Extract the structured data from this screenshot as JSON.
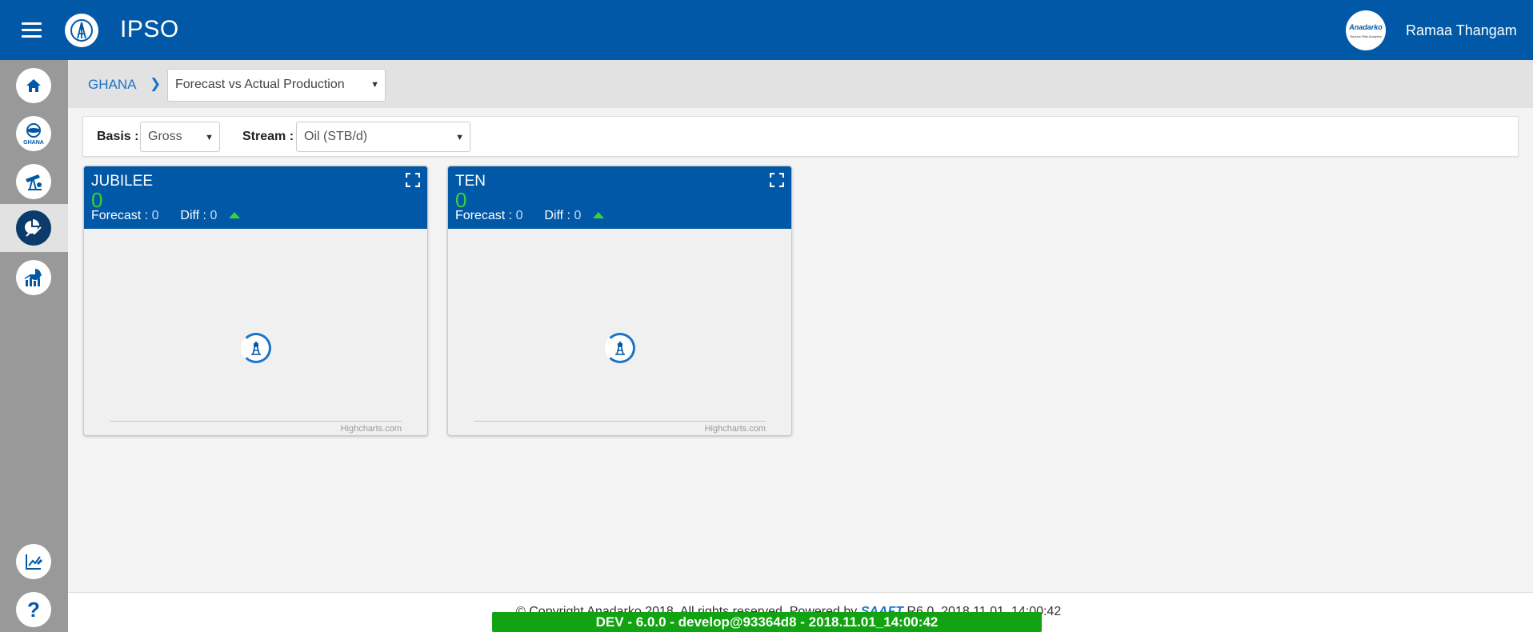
{
  "header": {
    "app_title": "IPSO",
    "user_name": "Ramaa Thangam",
    "avatar_brand": "Anadarko",
    "avatar_sub": "Reduce Risk Analytics",
    "menu_icon": "hamburger-icon",
    "logo_icon": "derrick-icon"
  },
  "sidebar": {
    "items": [
      {
        "icon": "home-icon"
      },
      {
        "icon": "ghana-icon",
        "label": "GHANA"
      },
      {
        "icon": "pumpjack-icon"
      },
      {
        "icon": "forecast-chart-icon",
        "active": true
      },
      {
        "icon": "analytics-chart-icon"
      },
      {
        "icon": "data-edit-icon"
      },
      {
        "icon": "help-icon",
        "label": "?"
      }
    ]
  },
  "breadcrumb": {
    "root": "GHANA",
    "separator": "❯",
    "page_select": "Forecast vs Actual Production"
  },
  "filters": {
    "basis_label": "Basis :",
    "basis_value": "Gross",
    "stream_label": "Stream :",
    "stream_value": "Oil (STB/d)"
  },
  "cards": [
    {
      "title": "JUBILEE",
      "value": "0",
      "forecast_label": "Forecast : ",
      "forecast_value": "0",
      "diff_label": "Diff : ",
      "diff_value": "0",
      "credits": "Highcharts.com"
    },
    {
      "title": "TEN",
      "value": "0",
      "forecast_label": "Forecast : ",
      "forecast_value": "0",
      "diff_label": "Diff : ",
      "diff_value": "0",
      "credits": "Highcharts.com"
    }
  ],
  "footer": {
    "copyright_left": "© Copyright Anadarko 2018. All rights reserved. Powered by ",
    "powered_brand": "SAAFT",
    "copyright_right": "  R6.0_2018.11.01_14:00:42",
    "dev_banner": "DEV - 6.0.0 - develop@93364d8 - 2018.11.01_14:00:42"
  },
  "colors": {
    "primary": "#0158a6",
    "positive": "#3ad13a",
    "dev_banner": "#12a312"
  }
}
